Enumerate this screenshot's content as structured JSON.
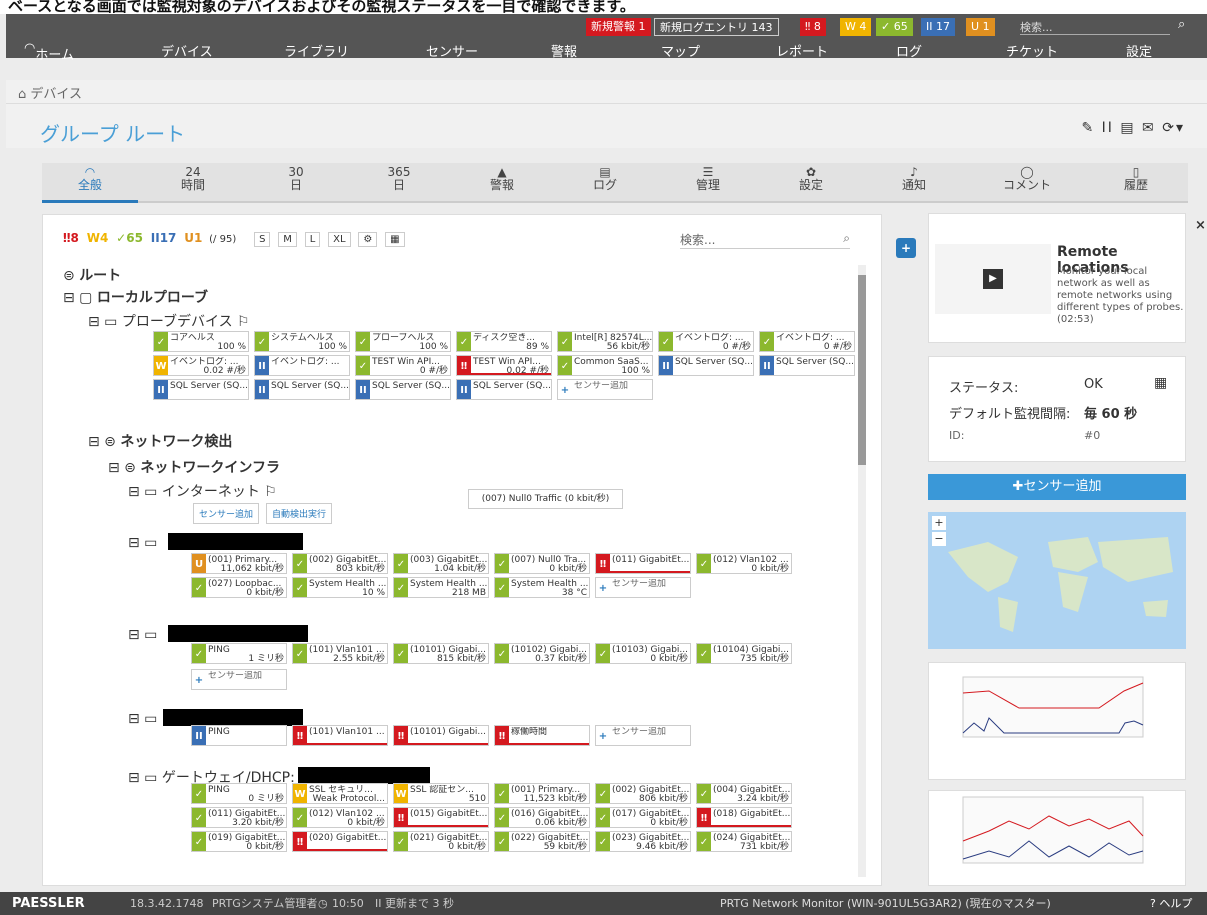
{
  "caption": "ベースとなる画面では監視対象のデバイスおよびその監視ステータスを一目で確認できます。",
  "topbar": {
    "new_alarms": "新規警報",
    "new_alarms_count": "1",
    "new_log": "新規ログエントリ",
    "new_log_count": "143",
    "down": "8",
    "warning": "4",
    "up": "65",
    "paused": "17",
    "unusual": "1",
    "search": "検索..."
  },
  "nav": [
    "ホーム",
    "デバイス",
    "ライブラリ",
    "センサー",
    "警報",
    "マップ",
    "レポート",
    "ログ",
    "チケット",
    "設定"
  ],
  "breadcrumb": "デバイス",
  "title": "グループ ルート",
  "tabs": [
    {
      "a": "",
      "b": "全般"
    },
    {
      "a": "24",
      "b": "時間"
    },
    {
      "a": "30",
      "b": "日"
    },
    {
      "a": "365",
      "b": "日"
    },
    {
      "a": "",
      "b": "警報"
    },
    {
      "a": "",
      "b": "ログ"
    },
    {
      "a": "",
      "b": "管理"
    },
    {
      "a": "",
      "b": "設定"
    },
    {
      "a": "",
      "b": "通知"
    },
    {
      "a": "",
      "b": "コメント"
    },
    {
      "a": "",
      "b": "履歴"
    }
  ],
  "toolbar": {
    "down": "8",
    "warning": "4",
    "up": "65",
    "paused": "17",
    "unusual": "1",
    "total": "(/ 95)",
    "sizes": [
      "S",
      "M",
      "L",
      "XL"
    ],
    "search": "検索..."
  },
  "tree": {
    "root": "ルート",
    "probe": "ローカルプローブ",
    "probe_device": "プローブデバイス",
    "netdisc": "ネットワーク検出",
    "infra": "ネットワークインフラ",
    "internet": "インターネット",
    "gateway": "ゲートウェイ/DHCP:",
    "add_sensor": "センサー追加",
    "auto_discover": "自動検出実行"
  },
  "rows": [
    [
      [
        "g",
        "コアヘルス",
        "100 %"
      ],
      [
        "g",
        "システムヘルス",
        "100 %"
      ],
      [
        "g",
        "プローブヘルス",
        "100 %"
      ],
      [
        "g",
        "ディスク空き...",
        "89 %"
      ],
      [
        "g",
        "Intel[R] 82574L...",
        "56 kbit/秒"
      ],
      [
        "g",
        "イベントログ: ...",
        "0 #/秒"
      ],
      [
        "g",
        "イベントログ: ...",
        "0 #/秒"
      ]
    ],
    [
      [
        "y",
        "イベントログ: ...",
        "0.02 #/秒"
      ],
      [
        "b",
        "イベントログ: ...",
        ""
      ],
      [
        "g",
        "TEST Win API...",
        "0 #/秒"
      ],
      [
        "r",
        "TEST Win API...",
        "0.02 #/秒"
      ],
      [
        "g",
        "Common SaaS...",
        "100 %"
      ],
      [
        "b",
        "SQL Server (SQ...",
        ""
      ],
      [
        "b",
        "SQL Server (SQ...",
        ""
      ]
    ],
    [
      [
        "b",
        "SQL Server (SQ...",
        ""
      ],
      [
        "b",
        "SQL Server (SQ...",
        ""
      ],
      [
        "b",
        "SQL Server (SQ...",
        ""
      ],
      [
        "b",
        "SQL Server (SQ...",
        ""
      ],
      [
        "w",
        "センサー追加",
        ""
      ]
    ],
    [
      [
        "o",
        "(001) Primary...",
        "11,062 kbit/秒"
      ],
      [
        "g",
        "(002) GigabitEt...",
        "803 kbit/秒"
      ],
      [
        "g",
        "(003) GigabitEt...",
        "1.04 kbit/秒"
      ],
      [
        "g",
        "(007) Null0 Tra...",
        "0 kbit/秒"
      ],
      [
        "r",
        "(011) GigabitEt...",
        ""
      ],
      [
        "g",
        "(012) Vlan102 ...",
        "0 kbit/秒"
      ]
    ],
    [
      [
        "g",
        "(027) Loopbac...",
        "0 kbit/秒"
      ],
      [
        "g",
        "System Health ...",
        "10 %"
      ],
      [
        "g",
        "System Health ...",
        "218 MB"
      ],
      [
        "g",
        "System Health ...",
        "38 °C"
      ],
      [
        "w",
        "センサー追加",
        ""
      ]
    ],
    [
      [
        "g",
        "PING",
        "1 ミリ秒"
      ],
      [
        "g",
        "(101) Vlan101 ...",
        "2.55 kbit/秒"
      ],
      [
        "g",
        "(10101) Gigabi...",
        "815 kbit/秒"
      ],
      [
        "g",
        "(10102) Gigabi...",
        "0.37 kbit/秒"
      ],
      [
        "g",
        "(10103) Gigabi...",
        "0 kbit/秒"
      ],
      [
        "g",
        "(10104) Gigabi...",
        "735 kbit/秒"
      ]
    ],
    [
      [
        "w",
        "センサー追加",
        ""
      ]
    ],
    [
      [
        "b",
        "PING",
        ""
      ],
      [
        "r",
        "(101) Vlan101 ...",
        ""
      ],
      [
        "r",
        "(10101) Gigabi...",
        ""
      ],
      [
        "r",
        "稼働時間",
        ""
      ],
      [
        "w",
        "センサー追加",
        ""
      ]
    ],
    [
      [
        "g",
        "PING",
        "0 ミリ秒"
      ],
      [
        "y",
        "SSL セキュリ...",
        "Weak Protocol..."
      ],
      [
        "y",
        "SSL 認証セン...",
        "510"
      ],
      [
        "g",
        "(001) Primary...",
        "11,523 kbit/秒"
      ],
      [
        "g",
        "(002) GigabitEt...",
        "806 kbit/秒"
      ],
      [
        "g",
        "(004) GigabitEt...",
        "3.24 kbit/秒"
      ]
    ],
    [
      [
        "g",
        "(011) GigabitEt...",
        "3.20 kbit/秒"
      ],
      [
        "g",
        "(012) Vlan102 ...",
        "0 kbit/秒"
      ],
      [
        "r",
        "(015) GigabitEt...",
        ""
      ],
      [
        "g",
        "(016) GigabitEt...",
        "0.06 kbit/秒"
      ],
      [
        "g",
        "(017) GigabitEt...",
        "0 kbit/秒"
      ],
      [
        "r",
        "(018) GigabitEt...",
        ""
      ]
    ],
    [
      [
        "g",
        "(019) GigabitEt...",
        "0 kbit/秒"
      ],
      [
        "r",
        "(020) GigabitEt...",
        ""
      ],
      [
        "g",
        "(021) GigabitEt...",
        "0 kbit/秒"
      ],
      [
        "g",
        "(022) GigabitEt...",
        "59 kbit/秒"
      ],
      [
        "g",
        "(023) GigabitEt...",
        "9.46 kbit/秒"
      ],
      [
        "g",
        "(024) GigabitEt...",
        "731 kbit/秒"
      ]
    ]
  ],
  "tooltip": "(007) Null0 Traffic (0 kbit/秒)",
  "remote": {
    "title": "Remote locations",
    "text": "Monitor your local network as well as remote networks using different types of probes. (02:53)"
  },
  "status": {
    "l1": "ステータス:",
    "v1": "OK",
    "l2": "デフォルト監視間隔:",
    "v2": "毎 60 秒",
    "l3": "ID:",
    "v3": "#0"
  },
  "add_sensor": "センサー追加",
  "footer": {
    "brand": "PAESSLER",
    "version": "18.3.42.1748",
    "user": "PRTGシステム管理者",
    "time": "10:50",
    "refresh": "更新まで 3 秒",
    "product": "PRTG Network Monitor",
    "server": "(WIN-901UL5G3AR2)",
    "master": "(現在のマスター)",
    "help": "ヘルプ"
  }
}
